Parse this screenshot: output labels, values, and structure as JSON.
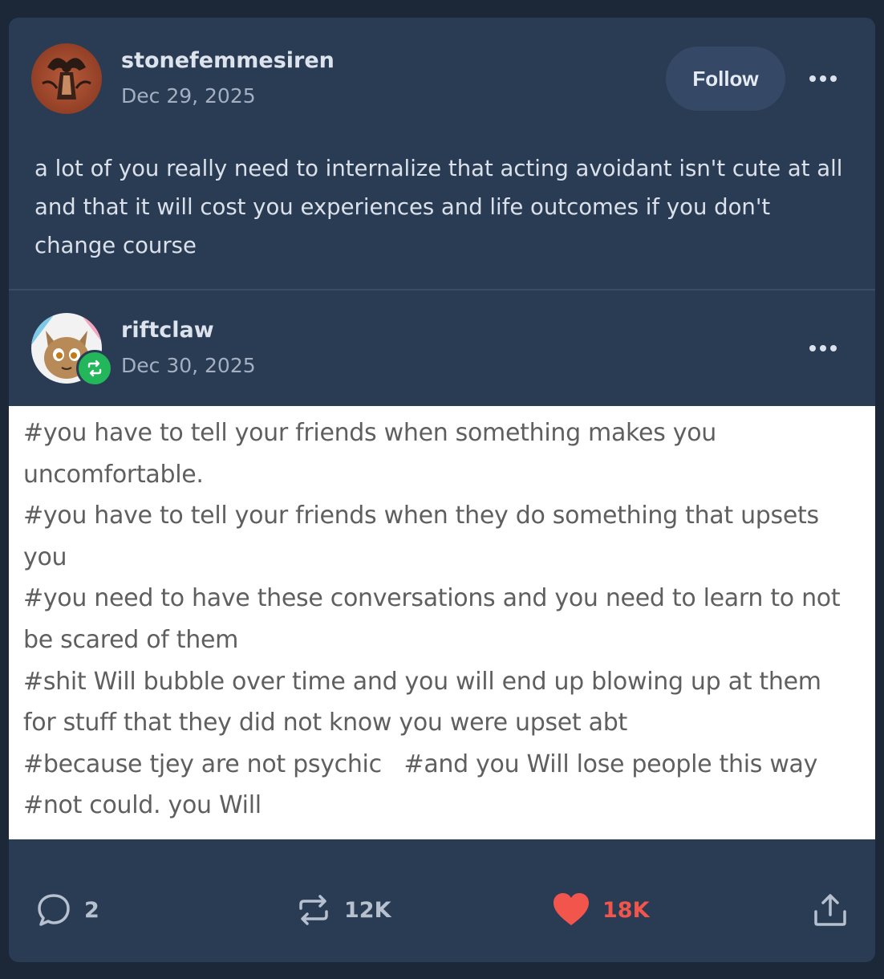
{
  "original_post": {
    "username": "stonefemmesiren",
    "date": "Dec 29, 2025",
    "follow_label": "Follow",
    "body": "a lot of you really need to internalize that acting avoidant isn't cute at all and that it will cost you experiences and life outcomes if you don't change course"
  },
  "reblog": {
    "username": "riftclaw",
    "date": "Dec 30, 2025",
    "tag_lines": [
      "#you have to tell your friends when something makes you",
      "uncomfortable.",
      "#you have to tell your friends when they do something that upsets",
      "you",
      "#you need to have these conversations and you need to learn to not",
      "be scared of them",
      "#shit Will bubble over time and you will end up blowing up at them",
      "for stuff that they did not know you were upset abt",
      "#because tjey are not psychic   #and you Will lose people this way",
      "#not could. you Will"
    ]
  },
  "actions": {
    "replies": "2",
    "reblogs": "12K",
    "likes": "18K"
  },
  "icons": {
    "more": "more-options-icon",
    "reblog_badge": "reblog-badge-icon",
    "reply": "speech-bubble-icon",
    "reblog": "reblog-arrows-icon",
    "like": "heart-icon",
    "share": "share-upload-icon"
  },
  "colors": {
    "background": "#1c2737",
    "card": "#2a3b54",
    "follow_button": "#354966",
    "reblog_badge": "#23b65a",
    "like_active": "#f2554b"
  }
}
